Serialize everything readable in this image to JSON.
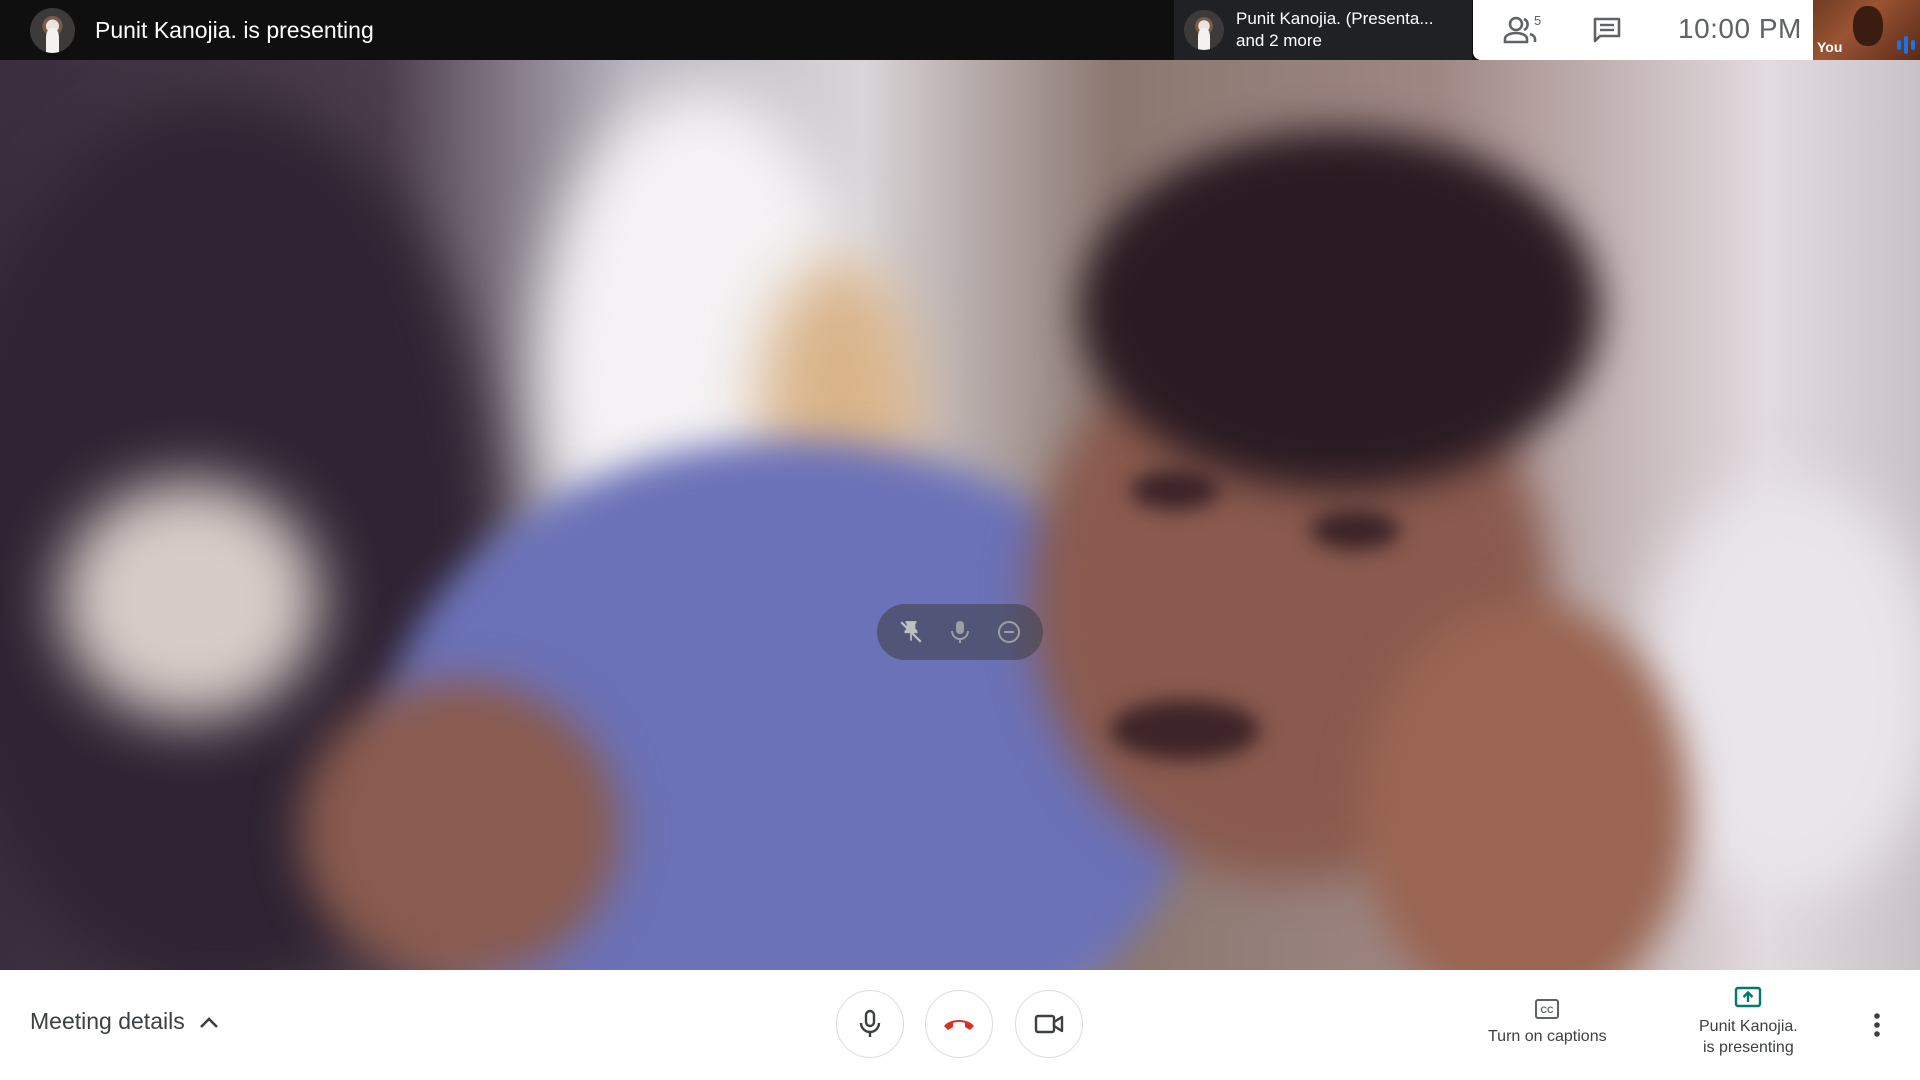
{
  "top": {
    "presenter_title": "Punit Kanojia. is presenting",
    "pinned_line1": "Punit Kanojia. (Presenta...",
    "pinned_line2": "and 2 more",
    "participants_count": "5",
    "time": "10:00  PM",
    "self_label": "You"
  },
  "hover_controls": {
    "icons": [
      "unpin-icon",
      "mic-icon",
      "remove-icon"
    ]
  },
  "bottom": {
    "meeting_details_label": "Meeting details",
    "captions_label": "Turn on captions",
    "presenting_line1": "Punit Kanojia.",
    "presenting_line2": "is presenting"
  },
  "colors": {
    "hangup": "#d93025",
    "present_accent": "#00796b",
    "icon_gray": "#5f6368"
  }
}
